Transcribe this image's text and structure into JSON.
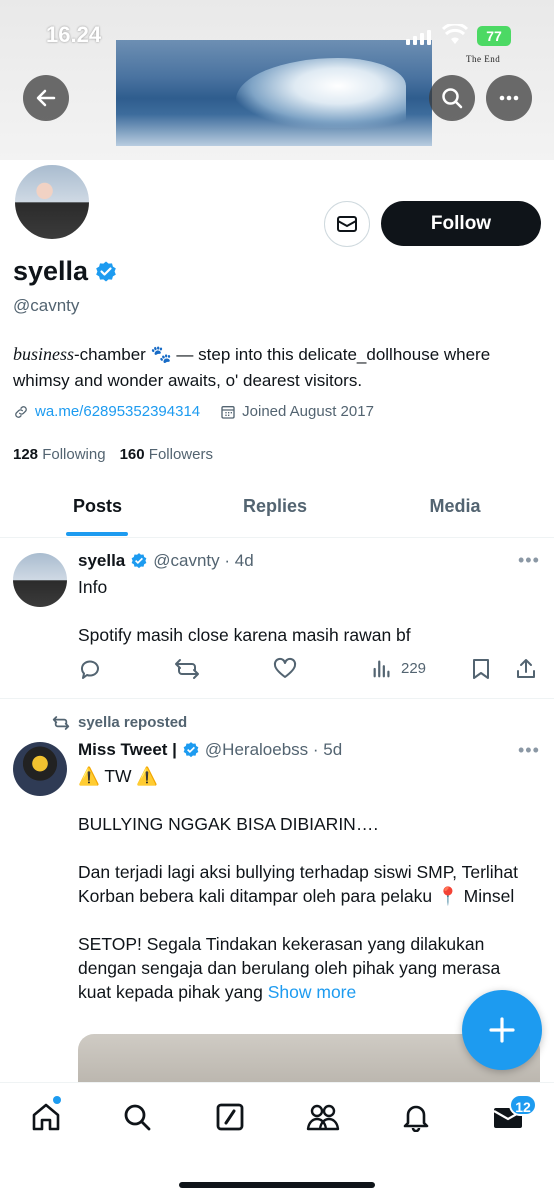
{
  "status_bar": {
    "time": "16.24",
    "battery": "77"
  },
  "banner": {
    "caption": "The End"
  },
  "profile": {
    "display_name": "syella",
    "handle": "@cavnty",
    "follow_label": "Follow",
    "bio_italic": "business",
    "bio_rest": "-chamber 🐾 — step into this delicate_dollhouse where whimsy and wonder awaits, o' dearest visitors.",
    "link": "wa.me/62895352394314",
    "joined": "Joined August 2017",
    "following_count": "128",
    "following_label": "Following",
    "followers_count": "160",
    "followers_label": "Followers"
  },
  "tabs": [
    {
      "label": "Posts"
    },
    {
      "label": "Replies"
    },
    {
      "label": "Media"
    }
  ],
  "tweets": [
    {
      "name": "syella",
      "handle_time": "@cavnty · 4d",
      "text": "Info\n\nSpotify masih close karena masih rawan bf",
      "views": "229"
    },
    {
      "repost_label": "syella reposted",
      "name": "Miss Tweet |",
      "handle_time": "@Heraloebss · 5d",
      "text": "⚠️ TW ⚠️\n\nBULLYING NGGAK BISA DIBIARIN….\n\nDan terjadi lagi aksi bullying  terhadap siswi SMP, Terlihat Korban bebera kali ditampar oleh para pelaku 📍 Minsel\n\nSETOP! Segala Tindakan kekerasan yang dilakukan dengan sengaja dan berulang oleh pihak yang merasa kuat kepada pihak yang ",
      "show_more": "Show more"
    }
  ],
  "nav": {
    "messages_badge": "12"
  },
  "colors": {
    "accent": "#1d9bf0",
    "text": "#0f1419",
    "muted": "#536471"
  }
}
